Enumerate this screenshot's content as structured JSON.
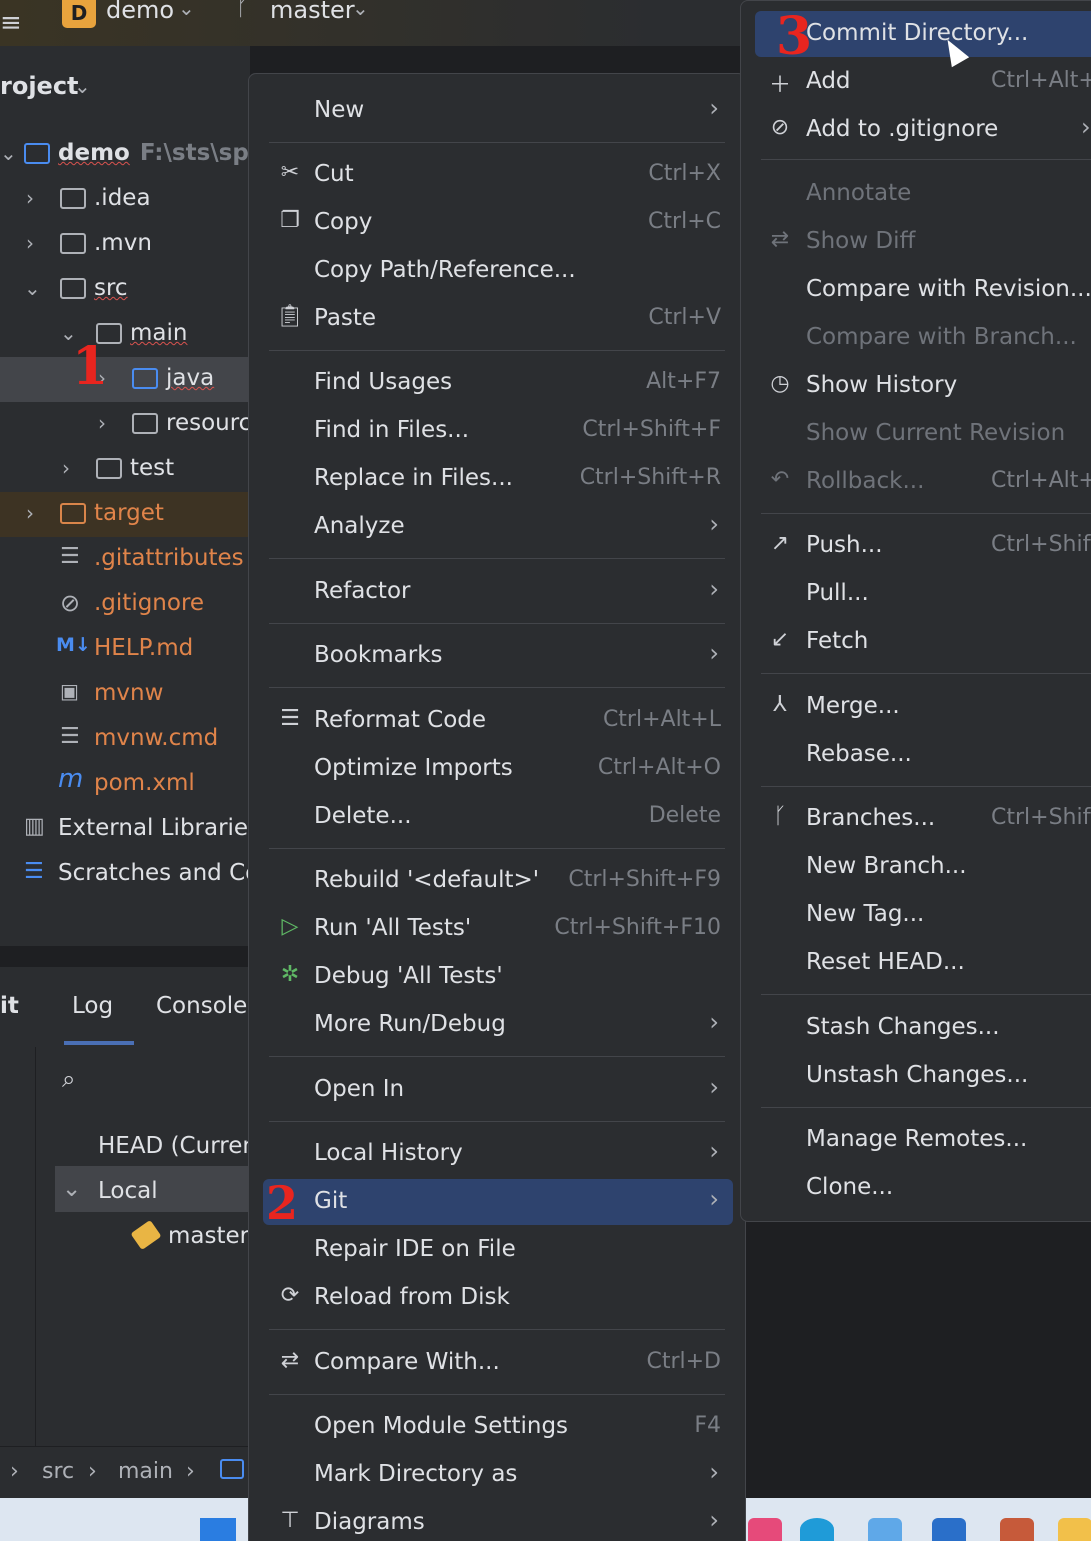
{
  "titlebar": {
    "menu_icon": "≡",
    "project_badge": "D",
    "project_name": "demo",
    "branch_name": "master"
  },
  "project_panel": {
    "title": "roject",
    "items": [
      {
        "label": "demo",
        "sub": "F:\\sts\\sprin"
      },
      {
        "label": ".idea"
      },
      {
        "label": ".mvn"
      },
      {
        "label": "src"
      },
      {
        "label": "main"
      },
      {
        "label": "java"
      },
      {
        "label": "resource"
      },
      {
        "label": "test"
      },
      {
        "label": "target"
      },
      {
        "label": ".gitattributes"
      },
      {
        "label": ".gitignore"
      },
      {
        "label": "HELP.md"
      },
      {
        "label": "mvnw"
      },
      {
        "label": "mvnw.cmd"
      },
      {
        "label": "pom.xml"
      },
      {
        "label": "External Libraries"
      },
      {
        "label": "Scratches and Cor"
      }
    ]
  },
  "git_panel": {
    "tabs": [
      "it",
      "Log",
      "Console"
    ],
    "rows": {
      "head": "HEAD (Current",
      "local": "Local",
      "master": "master"
    }
  },
  "breadcrumb": [
    "src",
    "main"
  ],
  "context_menu": {
    "items": [
      {
        "label": "New"
      },
      {
        "label": "Cut",
        "shortcut": "Ctrl+X"
      },
      {
        "label": "Copy",
        "shortcut": "Ctrl+C"
      },
      {
        "label": "Copy Path/Reference..."
      },
      {
        "label": "Paste",
        "shortcut": "Ctrl+V"
      },
      {
        "label": "Find Usages",
        "shortcut": "Alt+F7"
      },
      {
        "label": "Find in Files...",
        "shortcut": "Ctrl+Shift+F"
      },
      {
        "label": "Replace in Files...",
        "shortcut": "Ctrl+Shift+R"
      },
      {
        "label": "Analyze"
      },
      {
        "label": "Refactor"
      },
      {
        "label": "Bookmarks"
      },
      {
        "label": "Reformat Code",
        "shortcut": "Ctrl+Alt+L"
      },
      {
        "label": "Optimize Imports",
        "shortcut": "Ctrl+Alt+O"
      },
      {
        "label": "Delete...",
        "shortcut": "Delete"
      },
      {
        "label": "Rebuild '<default>'",
        "shortcut": "Ctrl+Shift+F9"
      },
      {
        "label": "Run 'All Tests'",
        "shortcut": "Ctrl+Shift+F10"
      },
      {
        "label": "Debug 'All Tests'"
      },
      {
        "label": "More Run/Debug"
      },
      {
        "label": "Open In"
      },
      {
        "label": "Local History"
      },
      {
        "label": "Git"
      },
      {
        "label": "Repair IDE on File"
      },
      {
        "label": "Reload from Disk"
      },
      {
        "label": "Compare With...",
        "shortcut": "Ctrl+D"
      },
      {
        "label": "Open Module Settings",
        "shortcut": "F4"
      },
      {
        "label": "Mark Directory as"
      },
      {
        "label": "Diagrams"
      }
    ]
  },
  "git_submenu": {
    "items": [
      {
        "label": "Commit Directory..."
      },
      {
        "label": "Add",
        "shortcut": "Ctrl+Alt+"
      },
      {
        "label": "Add to .gitignore"
      },
      {
        "label": "Annotate"
      },
      {
        "label": "Show Diff"
      },
      {
        "label": "Compare with Revision..."
      },
      {
        "label": "Compare with Branch..."
      },
      {
        "label": "Show History"
      },
      {
        "label": "Show Current Revision"
      },
      {
        "label": "Rollback...",
        "shortcut": "Ctrl+Alt+"
      },
      {
        "label": "Push...",
        "shortcut": "Ctrl+Shift+"
      },
      {
        "label": "Pull..."
      },
      {
        "label": "Fetch"
      },
      {
        "label": "Merge..."
      },
      {
        "label": "Rebase..."
      },
      {
        "label": "Branches...",
        "shortcut": "Ctrl+Shift+"
      },
      {
        "label": "New Branch..."
      },
      {
        "label": "New Tag..."
      },
      {
        "label": "Reset HEAD..."
      },
      {
        "label": "Stash Changes..."
      },
      {
        "label": "Unstash Changes..."
      },
      {
        "label": "Manage Remotes..."
      },
      {
        "label": "Clone..."
      }
    ]
  },
  "annotations": [
    "1",
    "2",
    "3"
  ],
  "colors": {
    "highlight": "#2e436e",
    "background": "#2b2d30",
    "annotation": "#e8251f"
  }
}
